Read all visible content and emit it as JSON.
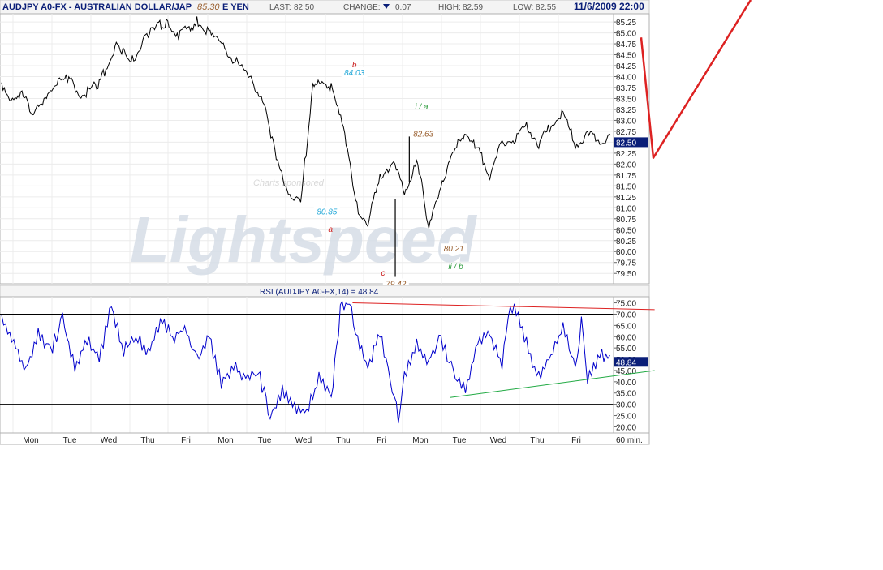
{
  "header": {
    "symbol": "AUDJPY A0-FX - AUSTRALIAN DOLLAR/JAP",
    "symbol_tail": "E YEN",
    "overlay_value": "85.30",
    "last_label": "LAST:",
    "last_value": "82.50",
    "change_label": "CHANGE:",
    "change_value": "0.07",
    "high_label": "HIGH:",
    "high_value": "82.59",
    "low_label": "LOW:",
    "low_value": "82.55",
    "datetime": "11/6/2009 22:00"
  },
  "watermark": {
    "sponsor_text": "Charts sponsored",
    "logo_text": "Lightspeed"
  },
  "rsi_header": "RSI (AUDJPY A0-FX,14) = 48.84",
  "x_axis": {
    "days": [
      "Mon",
      "Tue",
      "Wed",
      "Thu",
      "Fri",
      "Mon",
      "Tue",
      "Wed",
      "Thu",
      "Fri",
      "Mon",
      "Tue",
      "Wed",
      "Thu",
      "Fri"
    ],
    "interval_label": "60 min."
  },
  "colors": {
    "price_line": "#000000",
    "rsi_line": "#0000cc",
    "trend_red": "#dd2222",
    "trend_green": "#22aa44",
    "badge_bg": "#0a1e78",
    "header_blue": "#0a1e78",
    "label_brown": "#9a6030",
    "label_cyan": "#22a8d8",
    "label_red": "#cc2222",
    "label_green": "#2a9a3a"
  },
  "chart_data": [
    {
      "type": "line",
      "title": "AUDJPY A0-FX - AUSTRALIAN DOLLAR/JAPANESE YEN",
      "ylim": [
        79.3,
        85.4
      ],
      "y_ticks": [
        "85.25",
        "85.00",
        "84.75",
        "84.50",
        "84.25",
        "84.00",
        "83.75",
        "83.50",
        "83.25",
        "83.00",
        "82.75",
        "82.50",
        "82.25",
        "82.00",
        "81.75",
        "81.50",
        "81.25",
        "81.00",
        "80.75",
        "80.50",
        "80.25",
        "80.00",
        "79.75",
        "79.50"
      ],
      "last_price": "82.50",
      "series": [
        {
          "x": [
            0,
            0.02,
            0.04,
            0.05,
            0.08,
            0.11,
            0.13,
            0.16,
            0.19,
            0.21,
            0.24,
            0.27,
            0.29,
            0.32,
            0.35,
            0.37,
            0.4,
            0.43,
            0.45,
            0.47,
            0.49,
            0.51,
            0.54,
            0.56,
            0.58,
            0.6,
            0.62,
            0.64,
            0.66,
            0.68,
            0.69,
            0.7,
            0.72,
            0.73,
            0.75,
            0.78,
            0.8,
            0.82,
            0.84,
            0.86,
            0.88,
            0.9,
            0.92,
            0.94,
            0.96,
            0.98,
            1.0
          ],
          "values": [
            83.8,
            83.3,
            83.6,
            83.0,
            83.7,
            83.9,
            83.5,
            83.8,
            84.7,
            84.2,
            84.9,
            85.2,
            84.9,
            85.2,
            84.8,
            84.5,
            84.0,
            83.4,
            82.0,
            81.3,
            81.0,
            83.8,
            83.7,
            82.9,
            81.0,
            80.6,
            81.6,
            82.0,
            81.3,
            81.9,
            81.4,
            80.4,
            81.5,
            81.8,
            82.6,
            82.3,
            81.7,
            82.4,
            82.5,
            82.8,
            82.4,
            82.8,
            83.1,
            82.4,
            82.6,
            82.5,
            82.5
          ],
          "spikes": [
            {
              "x": 0.645,
              "low": 79.42
            },
            {
              "x": 0.668,
              "high": 82.63
            }
          ]
        }
      ],
      "annotations": [
        {
          "text": "b",
          "price": 84.2,
          "x": 0.578,
          "color": "label_red"
        },
        {
          "text": "84.03",
          "price": 84.03,
          "x": 0.578,
          "color": "label_cyan"
        },
        {
          "text": "80.85",
          "price": 80.85,
          "x": 0.533,
          "color": "label_cyan"
        },
        {
          "text": "a",
          "price": 80.45,
          "x": 0.539,
          "color": "label_red"
        },
        {
          "text": "i / a",
          "price": 83.25,
          "x": 0.688,
          "color": "label_green"
        },
        {
          "text": "82.63",
          "price": 82.63,
          "x": 0.691,
          "color": "label_brown"
        },
        {
          "text": "80.21",
          "price": 80.0,
          "x": 0.741,
          "color": "label_brown"
        },
        {
          "text": "ii / b",
          "price": 79.6,
          "x": 0.744,
          "color": "label_green"
        },
        {
          "text": "c",
          "price": 79.45,
          "x": 0.625,
          "color": "label_red"
        },
        {
          "text": "79.42",
          "price": 79.2,
          "x": 0.646,
          "color": "label_brown"
        }
      ]
    },
    {
      "type": "line",
      "title": "RSI (AUDJPY A0-FX,14) = 48.84",
      "ylim": [
        18,
        77
      ],
      "y_ticks": [
        "75.00",
        "70.00",
        "65.00",
        "60.00",
        "55.00",
        "50.00",
        "45.00",
        "40.00",
        "35.00",
        "30.00",
        "25.00",
        "20.00"
      ],
      "reference_lines": [
        70,
        30
      ],
      "last_value": "48.84",
      "series": [
        {
          "x": [
            0,
            0.02,
            0.04,
            0.06,
            0.08,
            0.1,
            0.12,
            0.14,
            0.16,
            0.18,
            0.2,
            0.22,
            0.24,
            0.26,
            0.28,
            0.3,
            0.32,
            0.34,
            0.36,
            0.38,
            0.4,
            0.42,
            0.44,
            0.46,
            0.48,
            0.5,
            0.52,
            0.54,
            0.555,
            0.57,
            0.58,
            0.6,
            0.62,
            0.64,
            0.65,
            0.66,
            0.68,
            0.7,
            0.72,
            0.74,
            0.76,
            0.78,
            0.8,
            0.82,
            0.83,
            0.84,
            0.86,
            0.88,
            0.9,
            0.92,
            0.94,
            0.95,
            0.96,
            0.98,
            1.0
          ],
          "values": [
            68,
            55,
            44,
            60,
            52,
            66,
            45,
            58,
            48,
            72,
            52,
            60,
            50,
            66,
            58,
            62,
            50,
            58,
            38,
            45,
            40,
            44,
            22,
            34,
            28,
            25,
            40,
            30,
            70,
            75,
            60,
            45,
            60,
            35,
            23,
            40,
            55,
            48,
            58,
            42,
            35,
            55,
            60,
            45,
            68,
            73,
            55,
            40,
            50,
            62,
            44,
            65,
            40,
            50,
            48.84
          ]
        }
      ],
      "trendlines": [
        {
          "color": "trend_red",
          "from": {
            "x": 0.575,
            "y": 75
          },
          "to": {
            "x": 1.07,
            "y": 72
          }
        },
        {
          "color": "trend_green",
          "from": {
            "x": 0.735,
            "y": 33
          },
          "to": {
            "x": 1.07,
            "y": 45
          }
        }
      ]
    },
    {
      "type": "line",
      "series": [
        {
          "name": "drawn check mark",
          "x": [
            0,
            0.06,
            0.54
          ],
          "values": [
            0.86,
            0.41,
            1.0
          ]
        }
      ]
    }
  ]
}
